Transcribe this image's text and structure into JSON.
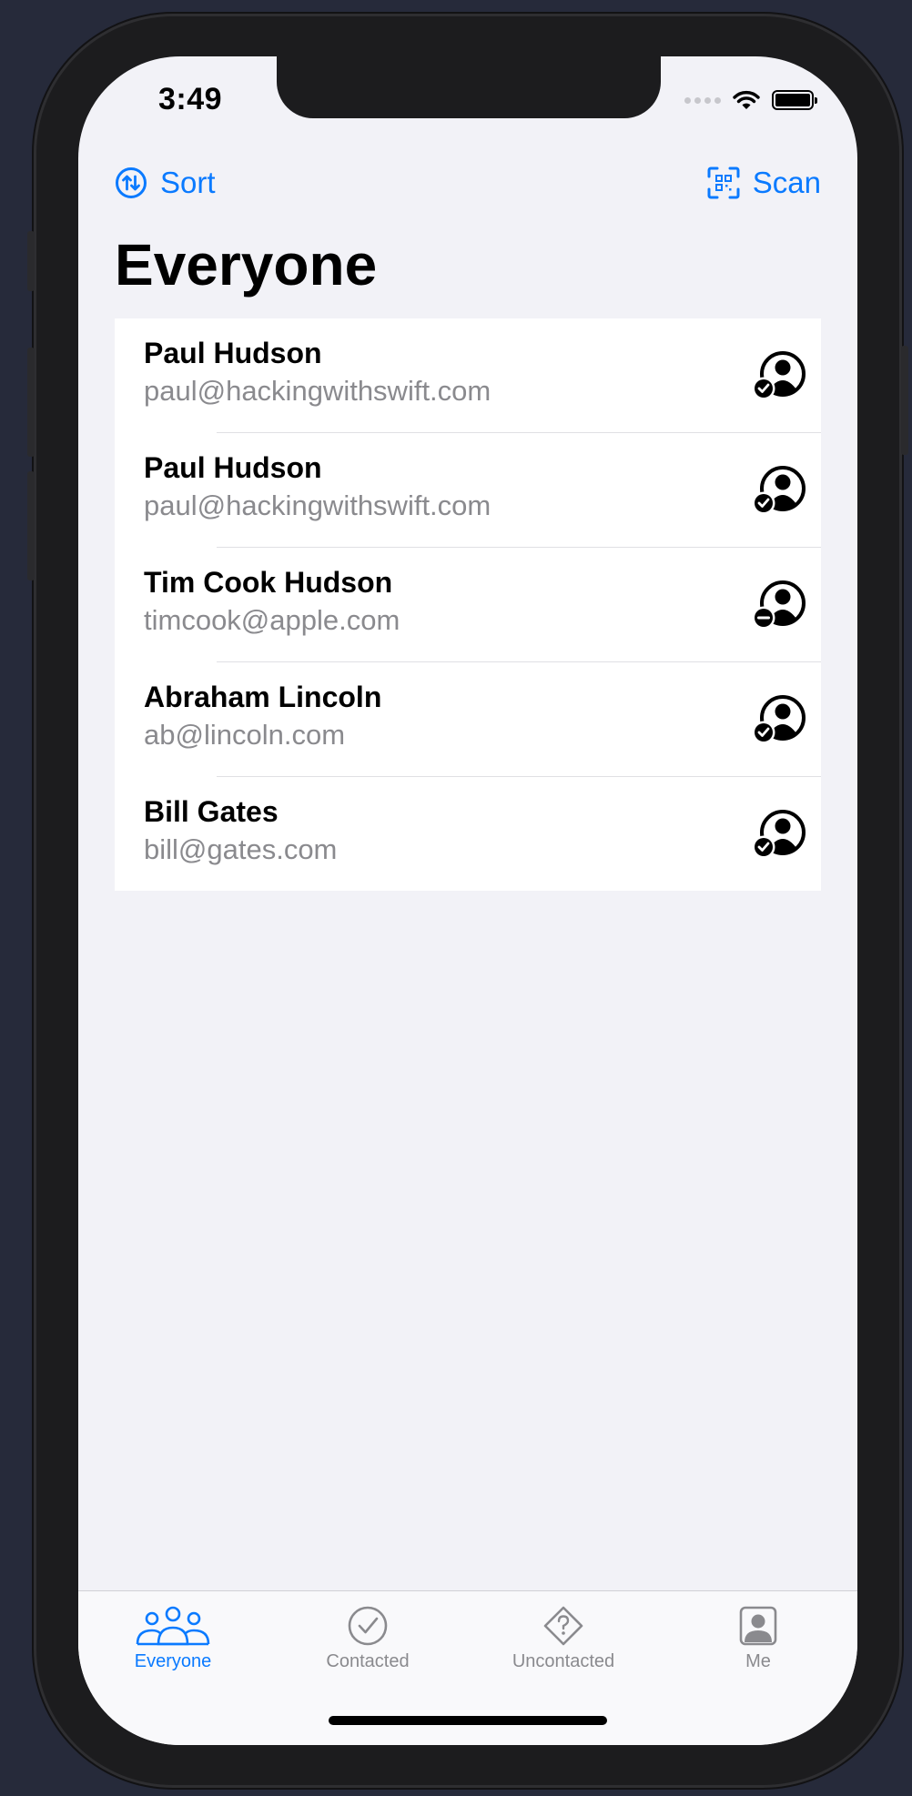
{
  "status_bar": {
    "time": "3:49"
  },
  "nav": {
    "sort_label": "Sort",
    "scan_label": "Scan",
    "title": "Everyone"
  },
  "prospects": [
    {
      "name": "Paul Hudson",
      "email": "paul@hackingwithswift.com",
      "status": "contacted"
    },
    {
      "name": "Paul Hudson",
      "email": "paul@hackingwithswift.com",
      "status": "contacted"
    },
    {
      "name": "Tim Cook Hudson",
      "email": "timcook@apple.com",
      "status": "uncontacted"
    },
    {
      "name": "Abraham Lincoln",
      "email": "ab@lincoln.com",
      "status": "contacted"
    },
    {
      "name": "Bill Gates",
      "email": "bill@gates.com",
      "status": "contacted"
    }
  ],
  "tabs": [
    {
      "label": "Everyone",
      "icon": "people-icon",
      "active": true
    },
    {
      "label": "Contacted",
      "icon": "checkmark-circle-icon",
      "active": false
    },
    {
      "label": "Uncontacted",
      "icon": "questionmark-diamond-icon",
      "active": false
    },
    {
      "label": "Me",
      "icon": "person-square-icon",
      "active": false
    }
  ],
  "colors": {
    "accent": "#0a7aff",
    "secondary_text": "#8a8a8e",
    "background": "#f2f2f7"
  }
}
